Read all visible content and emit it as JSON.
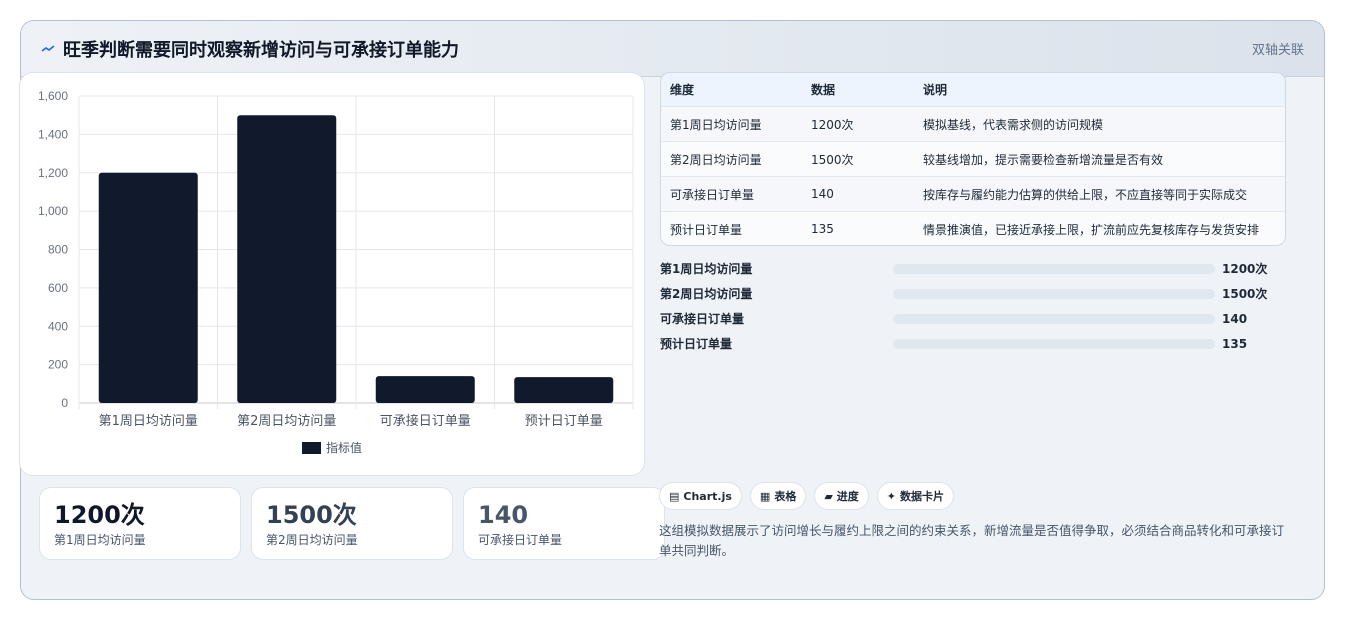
{
  "header": {
    "title": "旺季判断需要同时观察新增访问与可承接订单能力",
    "badge": "双轴关联",
    "icon": "sparkline-icon"
  },
  "chart_data": {
    "type": "bar",
    "categories": [
      "第1周日均访问量",
      "第2周日均访问量",
      "可承接日订单量",
      "预计日订单量"
    ],
    "series": [
      {
        "name": "指标值",
        "values": [
          1200,
          1500,
          140,
          135
        ]
      }
    ],
    "ylim": [
      0,
      1600
    ],
    "yticks": [
      "0",
      "200",
      "400",
      "600",
      "800",
      "1,000",
      "1,200",
      "1,400",
      "1,600"
    ],
    "ytick_values": [
      0,
      200,
      400,
      600,
      800,
      1000,
      1200,
      1400,
      1600
    ],
    "grid": true,
    "legend": "bottom",
    "bar_color": "#111a2c"
  },
  "stats": [
    {
      "value": "1200次",
      "label": "第1周日均访问量",
      "color": "#0f172a"
    },
    {
      "value": "1500次",
      "label": "第2周日均访问量",
      "color": "#334155"
    },
    {
      "value": "140",
      "label": "可承接日订单量",
      "color": "#475569"
    }
  ],
  "table": {
    "headers": [
      "维度",
      "数据",
      "说明"
    ],
    "rows": [
      [
        "第1周日均访问量",
        "1200次",
        "模拟基线，代表需求侧的访问规模"
      ],
      [
        "第2周日均访问量",
        "1500次",
        "较基线增加，提示需要检查新增流量是否有效"
      ],
      [
        "可承接日订单量",
        "140",
        "按库存与履约能力估算的供给上限，不应直接等同于实际成交"
      ],
      [
        "预计日订单量",
        "135",
        "情景推演值，已接近承接上限，扩流前应先复核库存与发货安排"
      ]
    ]
  },
  "progress": [
    {
      "label": "第1周日均访问量",
      "value_text": "1200次",
      "fraction": 0.485
    },
    {
      "label": "第2周日均访问量",
      "value_text": "1500次",
      "fraction": 0.485
    },
    {
      "label": "可承接日订单量",
      "value_text": "140",
      "fraction": 0.485
    },
    {
      "label": "预计日订单量",
      "value_text": "135",
      "fraction": 0.485
    }
  ],
  "tags": [
    {
      "icon": "▤",
      "label": "Chart.js",
      "icon_name": "chart-icon"
    },
    {
      "icon": "▦",
      "label": "表格",
      "icon_name": "table-icon"
    },
    {
      "icon": "▰",
      "label": "进度",
      "icon_name": "progress-icon"
    },
    {
      "icon": "✦",
      "label": "数据卡片",
      "icon_name": "card-icon"
    }
  ],
  "description": "这组模拟数据展示了访问增长与履约上限之间的约束关系，新增流量是否值得争取，必须结合商品转化和可承接订单共同判断。"
}
